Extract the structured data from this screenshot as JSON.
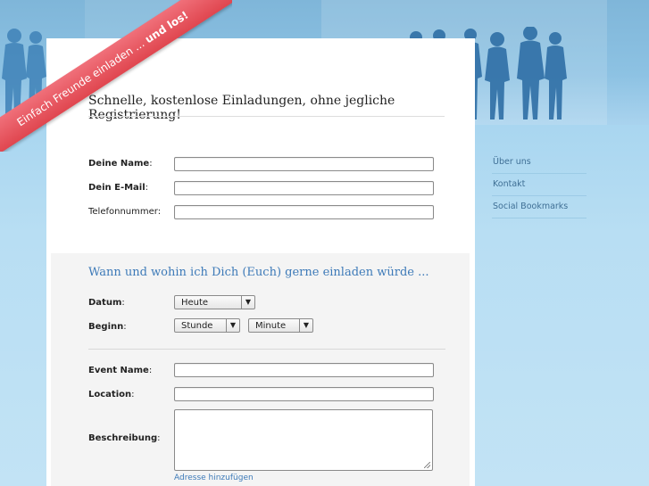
{
  "ribbon": {
    "text": "Einfach Freunde einladen ...",
    "emphasis": "und los!"
  },
  "headline": "Schnelle, kostenlose Einladungen, ohne jegliche Registrierung!",
  "contact": {
    "name_label": "Deine Name",
    "email_label": "Dein E-Mail",
    "phone_label": "Telefonnummer:",
    "colon": ":"
  },
  "event_section": {
    "title": "Wann und wohin ich Dich (Euch) gerne einladen würde ...",
    "date_label": "Datum",
    "date_value": "Heute",
    "begin_label": "Beginn",
    "hour_value": "Stunde",
    "minute_value": "Minute",
    "event_name_label": "Event Name",
    "location_label": "Location",
    "description_label": "Beschreibung",
    "colon": ":",
    "add_address_link": "Adresse hinzufügen"
  },
  "nav": {
    "items": [
      "Über uns",
      "Kontakt",
      "Social Bookmarks"
    ]
  },
  "colors": {
    "ribbon": "#e0464f",
    "accent": "#3d7ab8",
    "background": "#bfe0f2"
  }
}
